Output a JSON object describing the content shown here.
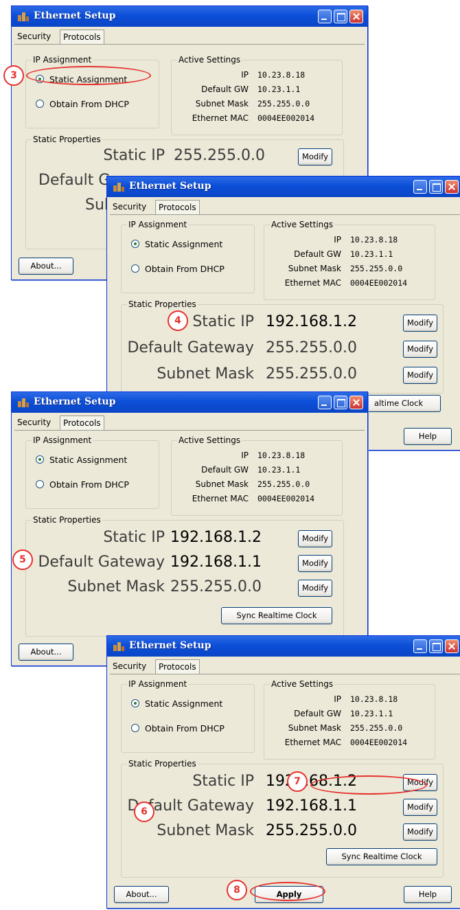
{
  "window_title": "Ethernet Setup",
  "tabs": [
    "Security",
    "Protocols"
  ],
  "ip_assignment": {
    "title": "IP Assignment",
    "static": "Static Assignment",
    "dhcp": "Obtain From DHCP"
  },
  "active_settings": {
    "title": "Active Settings",
    "rows": [
      {
        "k": "IP",
        "v": "10.23.8.18"
      },
      {
        "k": "Default GW",
        "v": "10.23.1.1"
      },
      {
        "k": "Subnet Mask",
        "v": "255.255.0.0"
      },
      {
        "k": "Ethernet MAC",
        "v": "0004EE002014"
      }
    ]
  },
  "static_properties": {
    "title": "Static Properties",
    "ip_label": "Static IP",
    "gw_label": "Default Gateway",
    "mask_label": "Subnet Mask",
    "gw_label_partial": "Default G",
    "mask_label_partial": "Subne"
  },
  "buttons": {
    "modify": "Modify",
    "sync": "Sync Realtime Clock",
    "sync_partial": "altime Clock",
    "about": "About...",
    "apply": "Apply",
    "help": "Help"
  },
  "windows": [
    {
      "step": "3",
      "ip": "255.255.0.0",
      "gw": "255.255.0.0",
      "mask": ""
    },
    {
      "step": "4",
      "ip": "192.168.1.2",
      "gw": "255.255.0.0",
      "mask": "255.255.0.0"
    },
    {
      "step": "5",
      "ip": "192.168.1.2",
      "gw": "192.168.1.1",
      "mask": "255.255.0.0"
    },
    {
      "steps": [
        "6",
        "7",
        "8"
      ],
      "ip": "192.168.1.2",
      "gw": "192.168.1.1",
      "mask": "255.255.0.0"
    }
  ],
  "colors": {
    "titlebar": "#0c4fd8",
    "dialog": "#ece9d8",
    "annotation": "#e6322e"
  }
}
